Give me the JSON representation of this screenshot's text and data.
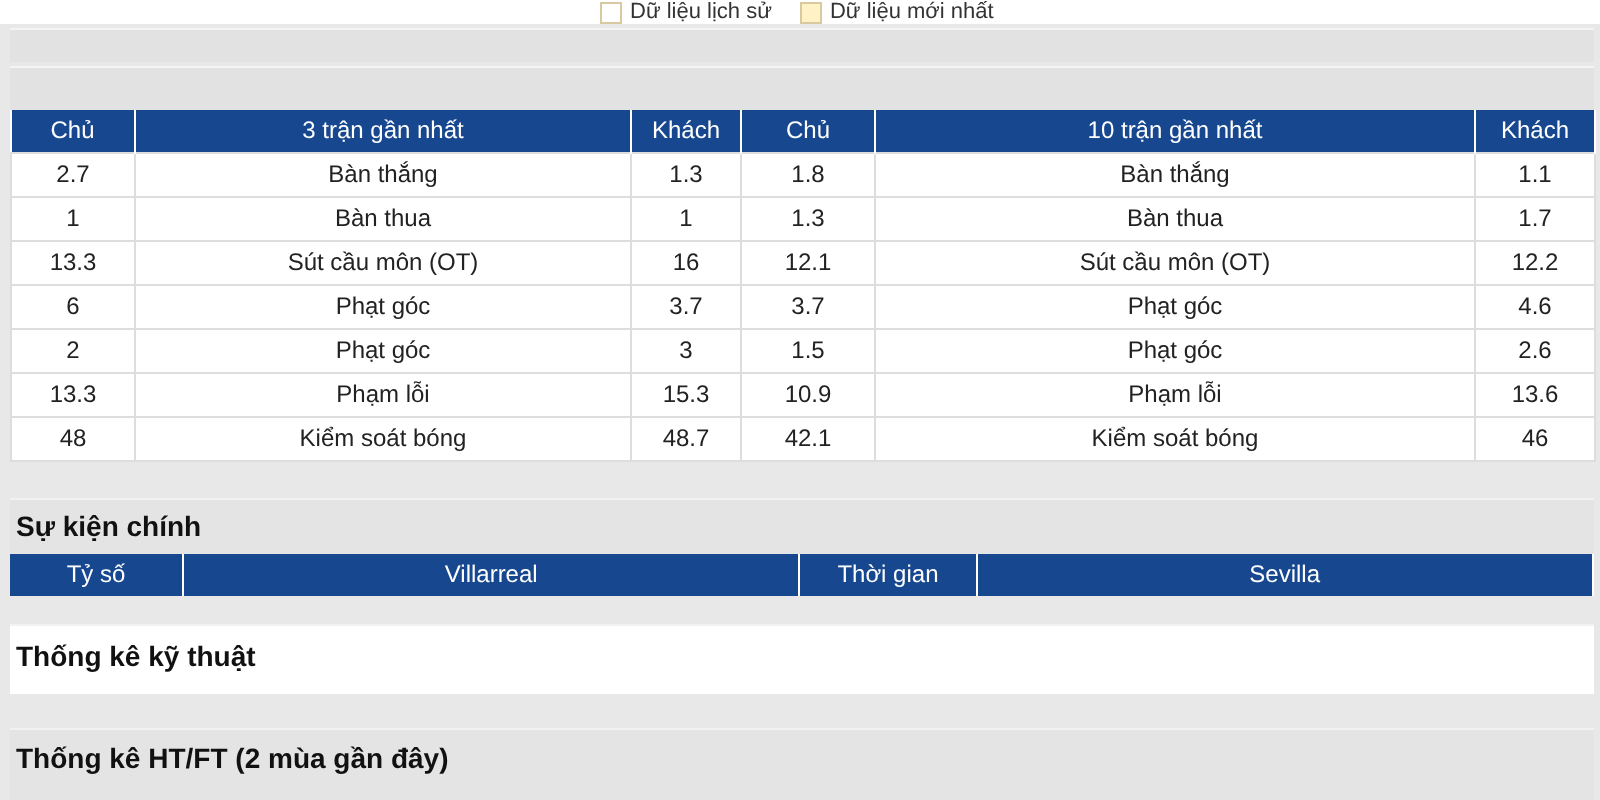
{
  "legend": [
    {
      "label": "Dữ liệu lịch sử",
      "color": "#ffffff"
    },
    {
      "label": "Dữ liệu mới nhất",
      "color": "#fff2c4"
    }
  ],
  "stats_table": {
    "columns": [
      "Chủ",
      "3 trận gần nhất",
      "Khách",
      "Chủ",
      "10 trận gần nhất",
      "Khách"
    ],
    "rows": [
      [
        "2.7",
        "Bàn thắng",
        "1.3",
        "1.8",
        "Bàn thắng",
        "1.1"
      ],
      [
        "1",
        "Bàn thua",
        "1",
        "1.3",
        "Bàn thua",
        "1.7"
      ],
      [
        "13.3",
        "Sút cầu môn (OT)",
        "16",
        "12.1",
        "Sút cầu môn (OT)",
        "12.2"
      ],
      [
        "6",
        "Phạt góc",
        "3.7",
        "3.7",
        "Phạt góc",
        "4.6"
      ],
      [
        "2",
        "Phạt góc",
        "3",
        "1.5",
        "Phạt góc",
        "2.6"
      ],
      [
        "13.3",
        "Phạm lỗi",
        "15.3",
        "10.9",
        "Phạm lỗi",
        "13.6"
      ],
      [
        "48",
        "Kiểm soát bóng",
        "48.7",
        "42.1",
        "Kiểm soát bóng",
        "46"
      ]
    ]
  },
  "main_events": {
    "title": "Sự kiện chính",
    "columns": [
      "Tỷ số",
      "Villarreal",
      "Thời gian",
      "Sevilla"
    ]
  },
  "technical_stats": {
    "title": "Thống kê kỹ thuật"
  },
  "htft_stats": {
    "title": "Thống kê HT/FT (2 mùa gần đây)"
  }
}
